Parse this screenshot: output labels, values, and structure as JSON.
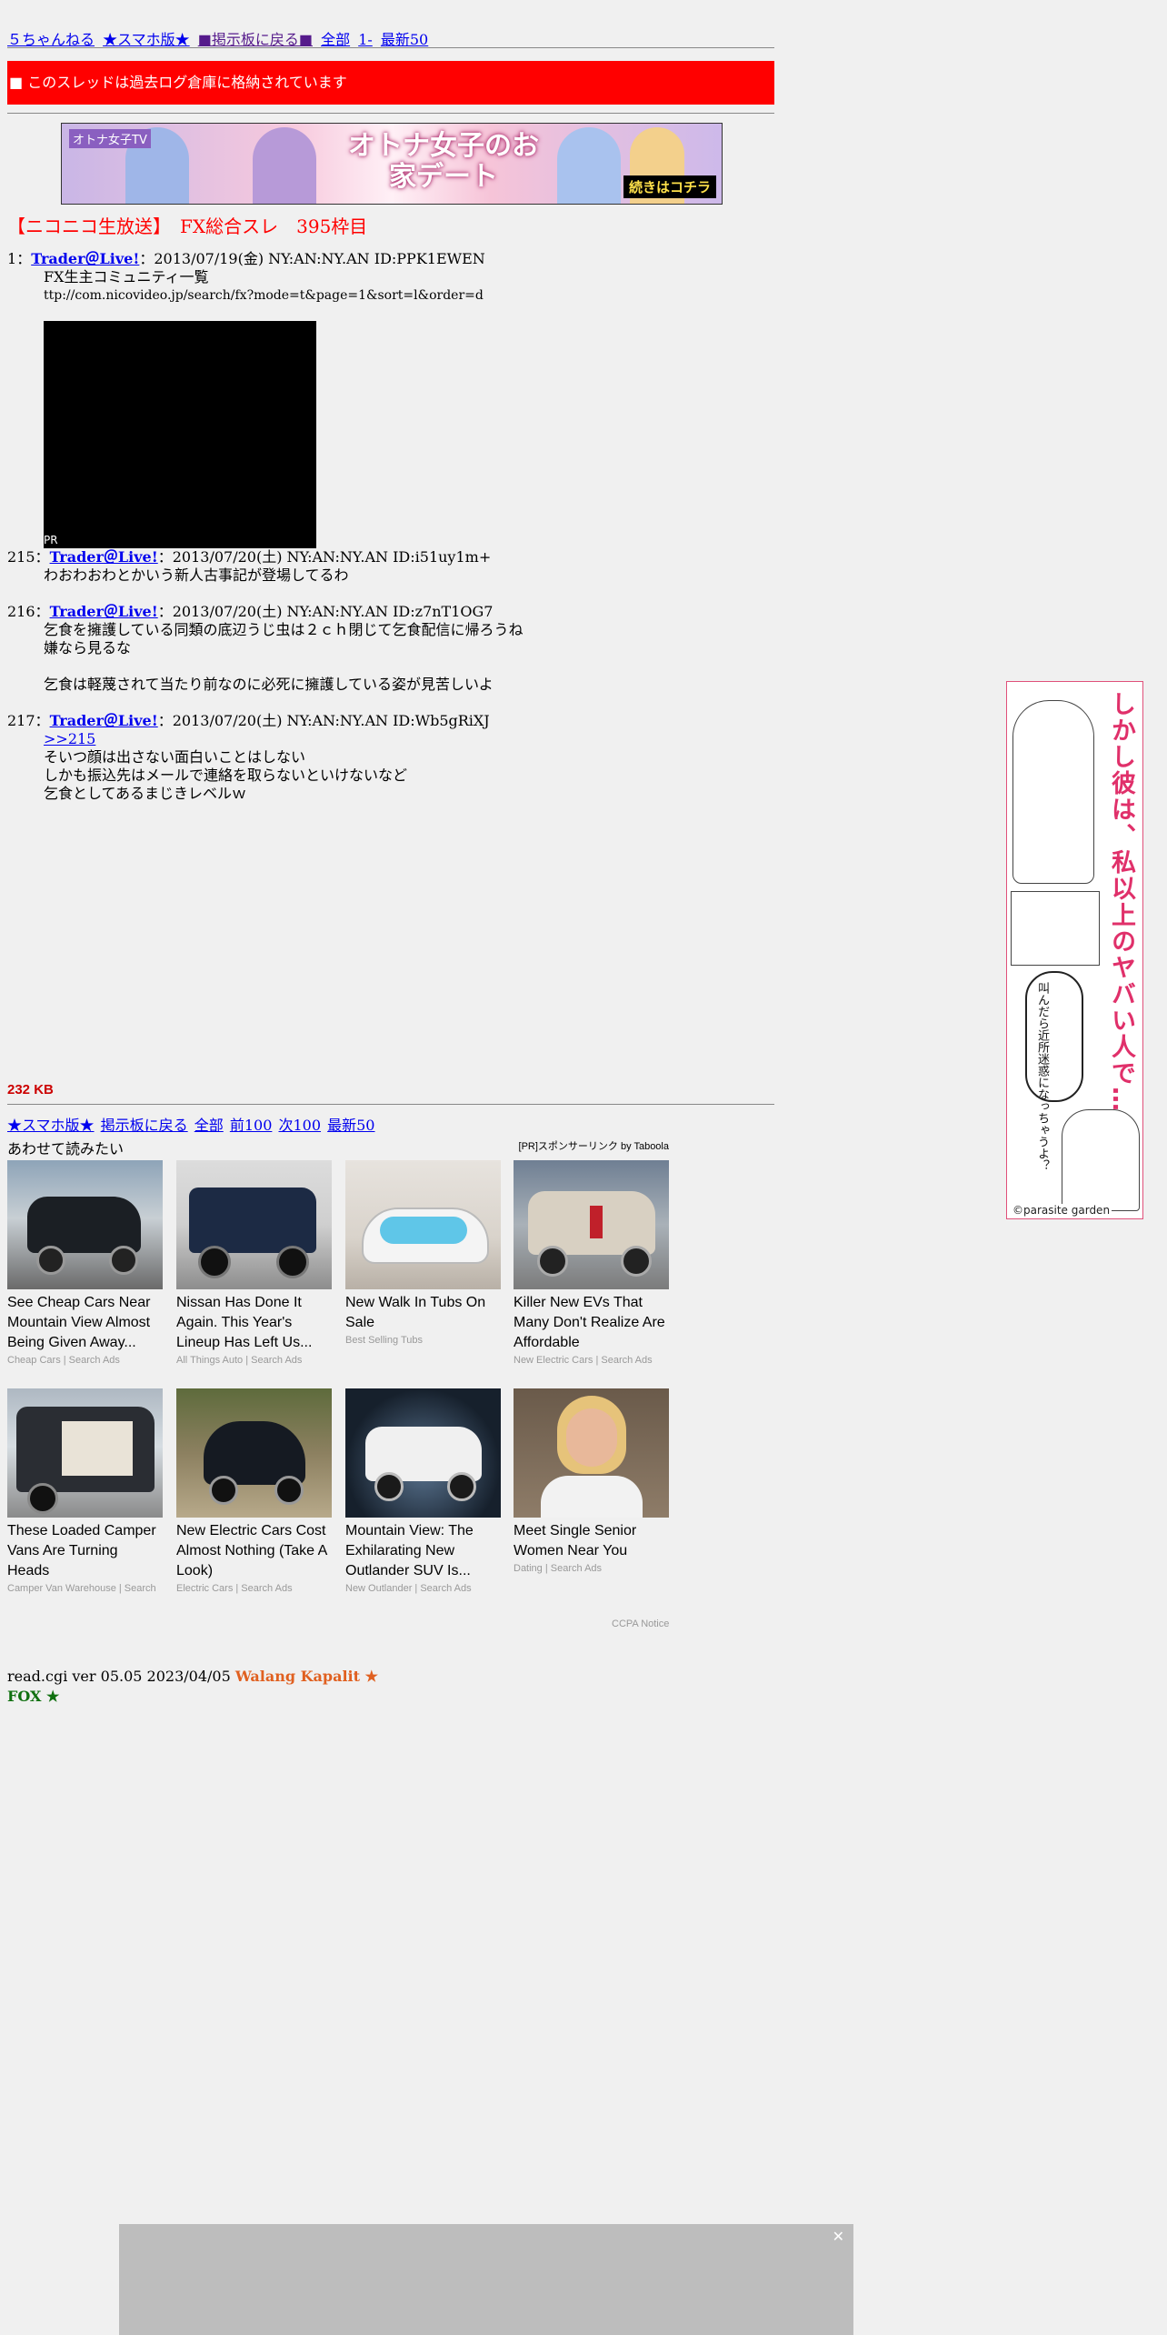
{
  "topnav": {
    "site": "５ちゃんねる",
    "sumaho": "★スマホ版★",
    "back": "■掲示板に戻る■",
    "all": "全部",
    "first": "1-",
    "latest": "最新50"
  },
  "archived_notice": "■ このスレッドは過去ログ倉庫に格納されています",
  "banner": {
    "tag": "オトナ女子TV",
    "title": "オトナ女子のお家デート",
    "cta": "続きはコチラ"
  },
  "thread_title": "【ニコニコ生放送】　FX総合スレ　395枠目",
  "posts": [
    {
      "num": "1",
      "sep": "：",
      "name": "Trader＠Live!",
      "meta": "：2013/07/19(金) NY:AN:NY.AN ID:PPK1EWEN",
      "lines": [
        "FX生主コミュニティ一覧",
        "ttp://com.nicovideo.jp/search/fx?mode=t&page=1&sort=l&order=d"
      ]
    },
    {
      "num": "215",
      "sep": "：",
      "name": "Trader＠Live!",
      "meta": "：2013/07/20(土) NY:AN:NY.AN ID:i51uy1m+",
      "lines": [
        "わおわおわとかいう新人古事記が登場してるわ"
      ]
    },
    {
      "num": "216",
      "sep": "：",
      "name": "Trader＠Live!",
      "meta": "：2013/07/20(土) NY:AN:NY.AN ID:z7nT1OG7",
      "lines": [
        "乞食を擁護している同類の底辺うじ虫は２ｃｈ閉じて乞食配信に帰ろうね",
        "嫌なら見るな",
        "",
        "乞食は軽蔑されて当たり前なのに必死に擁護している姿が見苦しいよ"
      ]
    },
    {
      "num": "217",
      "sep": "：",
      "name": "Trader＠Live!",
      "meta": "：2013/07/20(土) NY:AN:NY.AN ID:Wb5gRiXJ",
      "reply": ">>215",
      "lines": [
        "そいつ顔は出さない面白いことはしない",
        "しかも振込先はメールで連絡を取らないといけないなど",
        "乞食としてあるまじきレベルｗ"
      ]
    }
  ],
  "pr_label": "PR",
  "size": "232 KB",
  "botnav": {
    "sumaho": "★スマホ版★",
    "back": "掲示板に戻る",
    "all": "全部",
    "prev": "前100",
    "next": "次100",
    "latest": "最新50"
  },
  "taboola": {
    "heading": "あわせて読みたい",
    "sponsor": "[PR]スポンサーリンク by Taboola",
    "cards": [
      {
        "title": "See Cheap Cars Near Mountain View Almost Being Given Away...",
        "source": "Cheap Cars | Search Ads"
      },
      {
        "title": "Nissan Has Done It Again. This Year's Lineup Has Left Us...",
        "source": "All Things Auto | Search Ads"
      },
      {
        "title": "New Walk In Tubs On Sale",
        "source": "Best Selling Tubs"
      },
      {
        "title": "Killer New EVs That Many Don't Realize Are Affordable",
        "source": "New Electric Cars | Search Ads"
      },
      {
        "title": "These Loaded Camper Vans Are Turning Heads",
        "source": "Camper Van Warehouse | Search"
      },
      {
        "title": "New Electric Cars Cost Almost Nothing (Take A Look)",
        "source": "Electric Cars | Search Ads"
      },
      {
        "title": "Mountain View: The Exhilarating New Outlander SUV Is...",
        "source": "New Outlander | Search Ads"
      },
      {
        "title": "Meet Single Senior Women Near You",
        "source": "Dating | Search Ads"
      }
    ],
    "ccpa": "CCPA Notice"
  },
  "footer": {
    "version": "read.cgi ver 05.05 2023/04/05",
    "walang": "Walang Kapalit ★",
    "fox": "FOX ★"
  },
  "side_ad": {
    "headline": "しかし彼は、私以上のヤバい人で…",
    "bubble": "叫んだら近所迷惑になっちゃうよ？",
    "credit": "©parasite garden"
  },
  "bottom_ad": {
    "close": "✕"
  },
  "colors": {
    "accent_red": "#ff0000",
    "link": "#0000ee",
    "visited": "#551a8b",
    "size_red": "#cc0000",
    "walang": "#e06020",
    "fox": "#107010"
  }
}
